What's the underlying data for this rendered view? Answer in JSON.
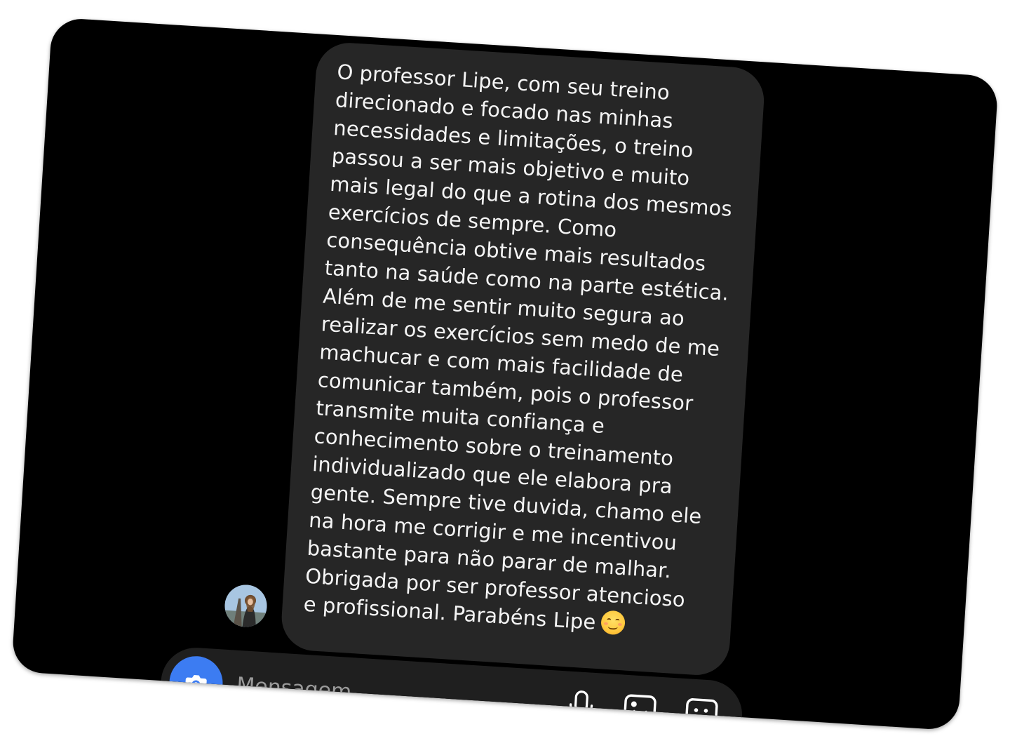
{
  "conversation": {
    "message": {
      "text": "O professor Lipe, com seu treino\ndirecionado e focado nas minhas\nnecessidades e limitações, o treino\npassou a ser mais objetivo e muito\nmais legal do que a rotina dos mesmos\nexercícios de sempre. Como\nconsequência obtive mais resultados\ntanto na saúde como na parte estética.\nAlém de me sentir muito segura ao\nrealizar os exercícios sem medo de me\nmachucar e com mais facilidade de\ncomunicar também, pois o professor\ntransmite muita confiança e\nconhecimento sobre o treinamento\nindividualizado que ele elabora pra\ngente. Sempre tive duvida, chamo ele\nna hora me corrigir e me incentivou\nbastante para não parar de malhar.\nObrigada por ser professor atencioso\ne profissional. Parabéns Lipe",
      "emoji": "smiling-face-with-smiling-eyes"
    },
    "sender_avatar": "avatar-photo"
  },
  "composer": {
    "placeholder": "Mensagem...",
    "camera_icon": "camera-icon",
    "mic_icon": "microphone-icon",
    "gallery_icon": "image-gallery-icon",
    "sticker_icon": "sticker-icon",
    "accent_color": "#3c7cf2"
  },
  "colors": {
    "background": "#000000",
    "bubble": "#262626",
    "text": "#f4f4f4",
    "placeholder": "#9a9a9a"
  }
}
